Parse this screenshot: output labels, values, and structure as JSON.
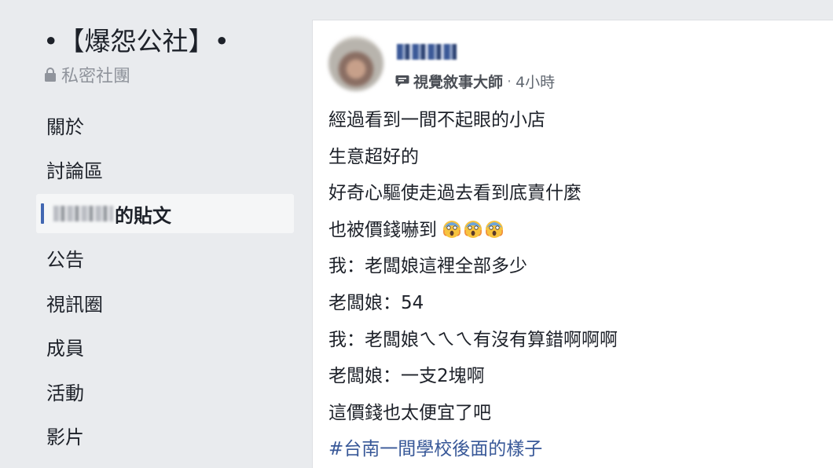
{
  "sidebar": {
    "group_title": "•【爆怨公社】•",
    "privacy_label": "私密社團",
    "nav": [
      {
        "label": "關於"
      },
      {
        "label": "討論區"
      },
      {
        "label": "的貼文",
        "active": true
      },
      {
        "label": "公告"
      },
      {
        "label": "視訊圈"
      },
      {
        "label": "成員"
      },
      {
        "label": "活動"
      },
      {
        "label": "影片"
      }
    ]
  },
  "post": {
    "badge": "視覺敘事大師",
    "separator": "·",
    "time": "4小時",
    "lines": [
      "經過看到一間不起眼的小店",
      "生意超好的",
      "好奇心驅使走過去看到底賣什麼",
      "也被價錢嚇到",
      "我：老闆娘這裡全部多少",
      "老闆娘：54",
      "我：老闆娘ㄟㄟㄟ有沒有算錯啊啊啊",
      "老闆娘：一支2塊啊",
      "這價錢也太便宜了吧"
    ],
    "hashtag": "#台南一間學校後面的樣子"
  },
  "icons": {
    "lock": "lock-icon",
    "badge": "chat-bubble-badge-icon",
    "emoji": "scream-emoji-icon"
  },
  "colors": {
    "background": "#e9ebee",
    "link": "#385898",
    "accent": "#4267b2",
    "text": "#1d2129",
    "muted": "#90949c"
  }
}
